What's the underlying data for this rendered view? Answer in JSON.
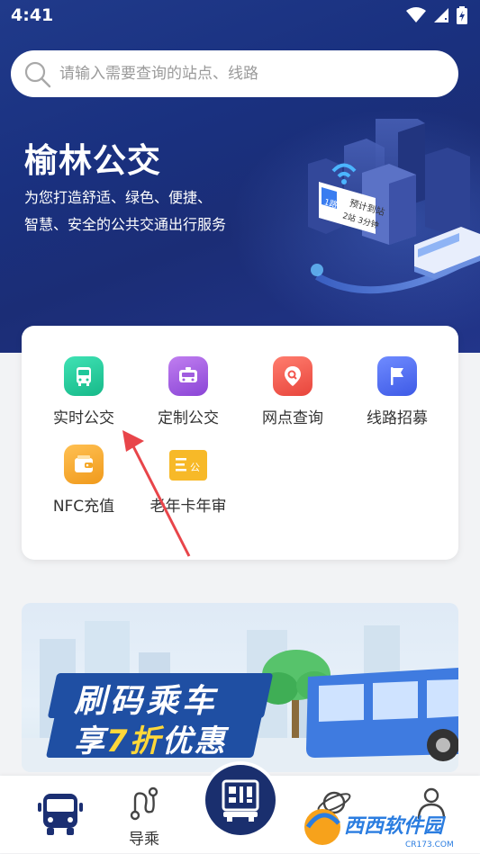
{
  "status_bar": {
    "time": "4:41"
  },
  "search": {
    "placeholder": "请输入需要查询的站点、线路"
  },
  "hero": {
    "title": "榆林公交",
    "subtitle_line1": "为您打造舒适、绿色、便捷、",
    "subtitle_line2": "智慧、安全的公共交通出行服务",
    "sign_route": "1路",
    "sign_line1": "预计到站",
    "sign_line2": "2站 3分钟"
  },
  "services": [
    {
      "label": "实时公交",
      "icon": "bus-icon",
      "color": "#1fc79a"
    },
    {
      "label": "定制公交",
      "icon": "custom-bus-icon",
      "color": "#a05ddf"
    },
    {
      "label": "网点查询",
      "icon": "location-search-icon",
      "color": "#f2564e"
    },
    {
      "label": "线路招募",
      "icon": "flag-icon",
      "color": "#4a6cf0"
    },
    {
      "label": "NFC充值",
      "icon": "wallet-icon",
      "color": "#f5a623"
    },
    {
      "label": "老年卡年审",
      "icon": "elder-card-icon",
      "color": "#f7b928"
    }
  ],
  "banner": {
    "line1": "刷码乘车",
    "line2_prefix": "享",
    "line2_highlight": "7折",
    "line2_suffix": "优惠"
  },
  "bottom_nav": [
    {
      "label": "",
      "icon": "bus-icon"
    },
    {
      "label": "导乘",
      "icon": "route-icon"
    },
    {
      "label": "",
      "icon": "qr-bus-icon"
    },
    {
      "label": "",
      "icon": "planet-icon"
    },
    {
      "label": "",
      "icon": "user-icon"
    }
  ],
  "watermark": {
    "text": "西西软件园",
    "sub": "CR173.COM"
  },
  "colors": {
    "primary": "#1b2f72",
    "accent": "#203a8a"
  }
}
